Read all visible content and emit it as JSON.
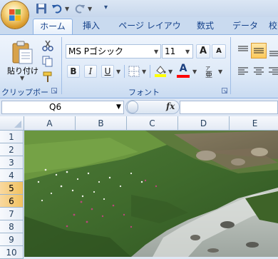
{
  "tabs": [
    "ホーム",
    "挿入",
    "ページ レイアウト",
    "数式",
    "データ",
    "校"
  ],
  "clipboard": {
    "paste_label": "貼り付け",
    "group_label": "クリップボード"
  },
  "font": {
    "name": "MS Pゴシック",
    "size": "11",
    "group_label": "フォント",
    "bold": "B",
    "italic": "I",
    "underline": "U",
    "grow": "A",
    "shrink": "A",
    "color_letter": "A"
  },
  "formula_bar": {
    "name_box": "Q6",
    "fx": "fx"
  },
  "columns": [
    "A",
    "B",
    "C",
    "D",
    "E"
  ],
  "rows": [
    "1",
    "2",
    "3",
    "4",
    "5",
    "6",
    "7",
    "8",
    "9",
    "10"
  ],
  "selected_row": "5",
  "colors": {
    "accent": "#15428b",
    "ribbon": "#dfeaf8",
    "row_selected": "#f4c870"
  }
}
